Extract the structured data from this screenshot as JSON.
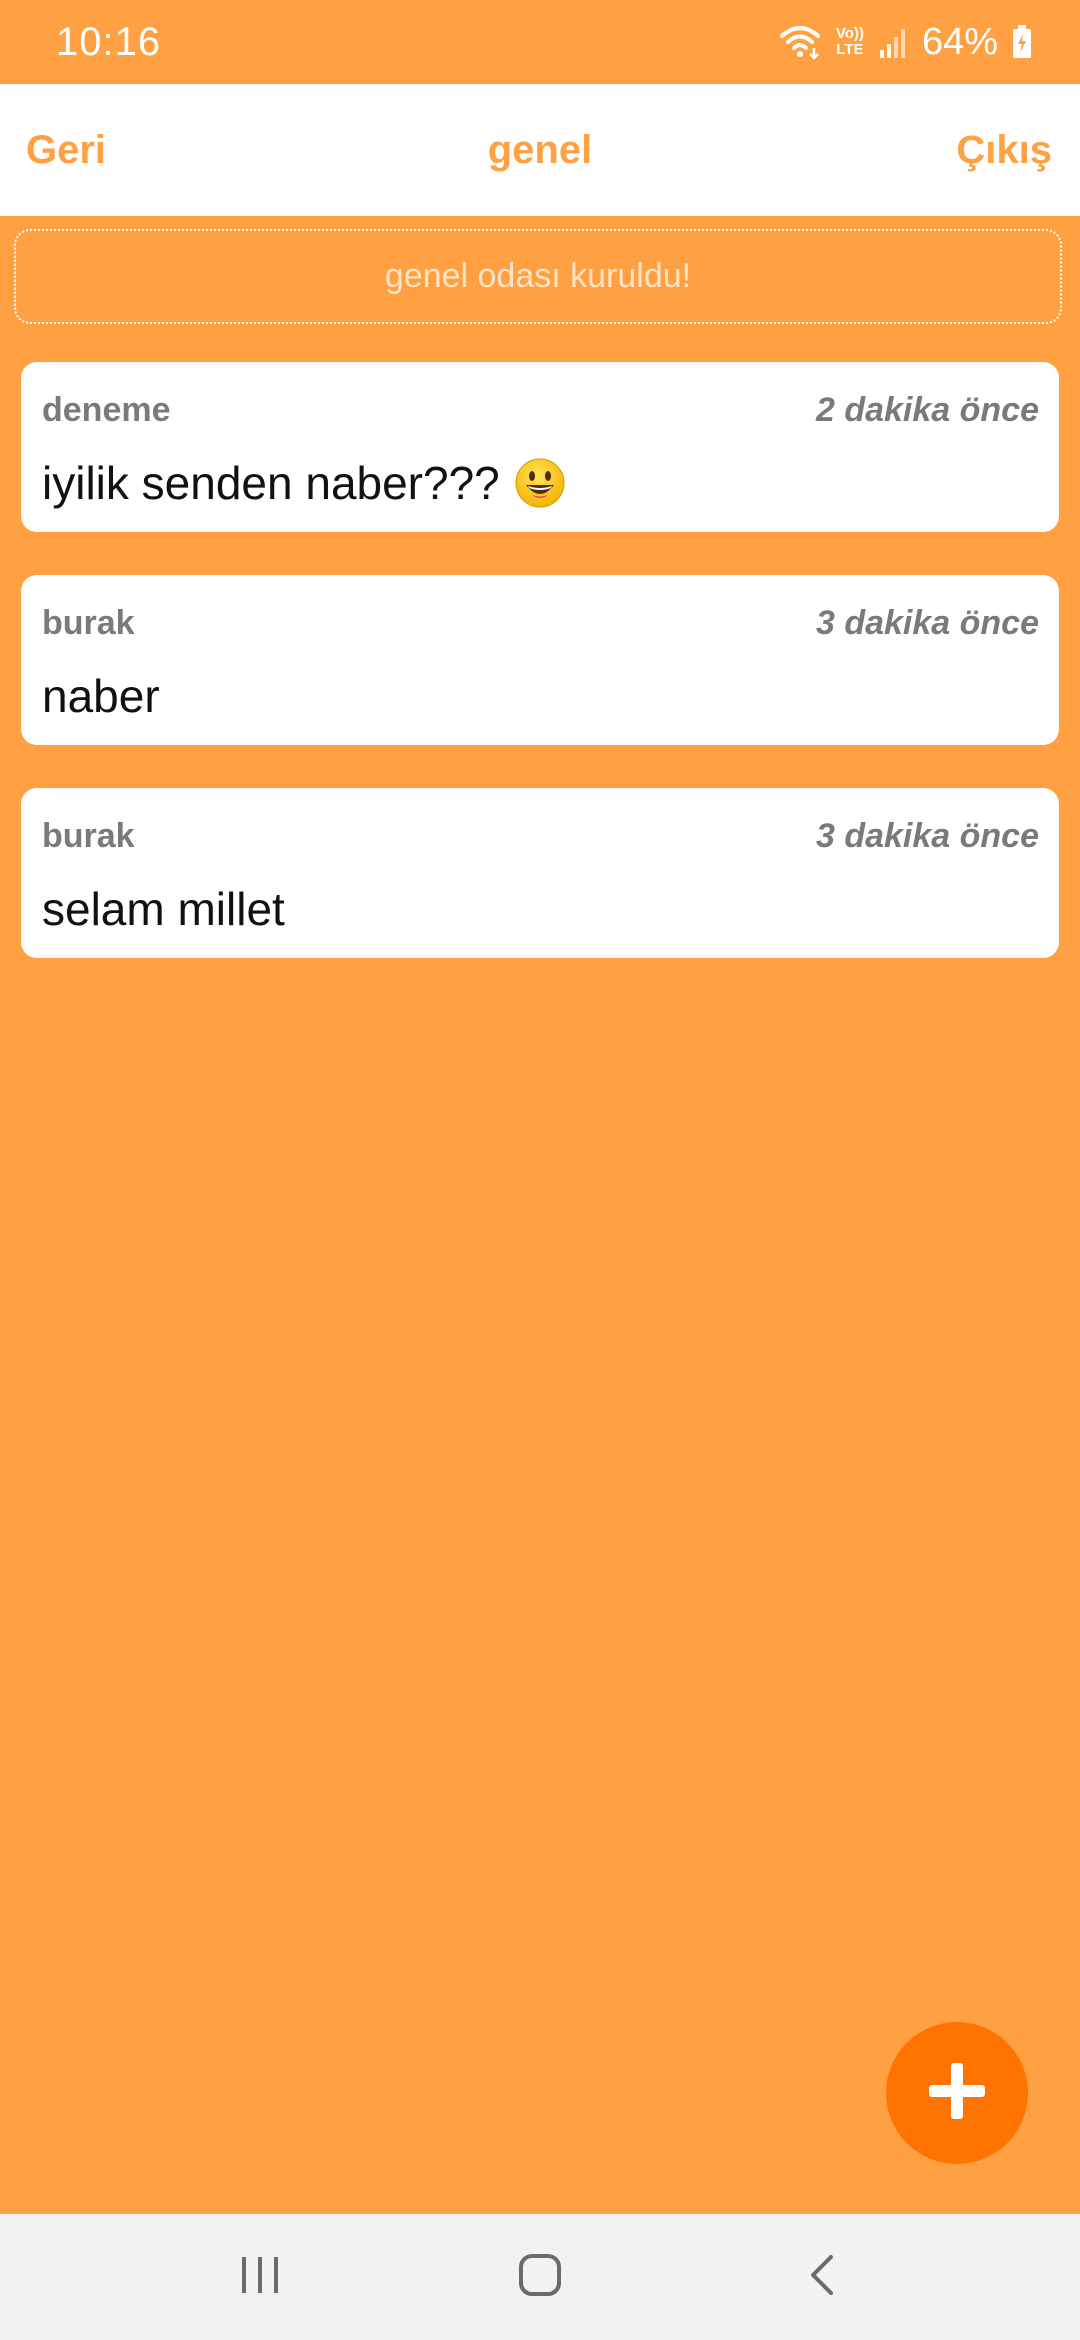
{
  "status_bar": {
    "time": "10:16",
    "volte_top": "Vo))",
    "volte_bottom": "LTE",
    "battery": "64%"
  },
  "header": {
    "back_label": "Geri",
    "title": "genel",
    "exit_label": "Çıkış"
  },
  "system_message": "genel odası kuruldu!",
  "messages": [
    {
      "author": "deneme",
      "time": "2 dakika önce",
      "text": "iyilik senden naber???",
      "emoji": "grinning-face"
    },
    {
      "author": "burak",
      "time": "3 dakika önce",
      "text": "naber"
    },
    {
      "author": "burak",
      "time": "3 dakika önce",
      "text": "selam millet"
    }
  ],
  "colors": {
    "background": "#FFA143",
    "accent": "#FF7300",
    "card": "#FFFFFF",
    "muted_text": "#7A7A7A"
  },
  "icons": {
    "fab": "plus-icon",
    "nav": [
      "recent-apps-icon",
      "home-icon",
      "back-icon"
    ]
  }
}
